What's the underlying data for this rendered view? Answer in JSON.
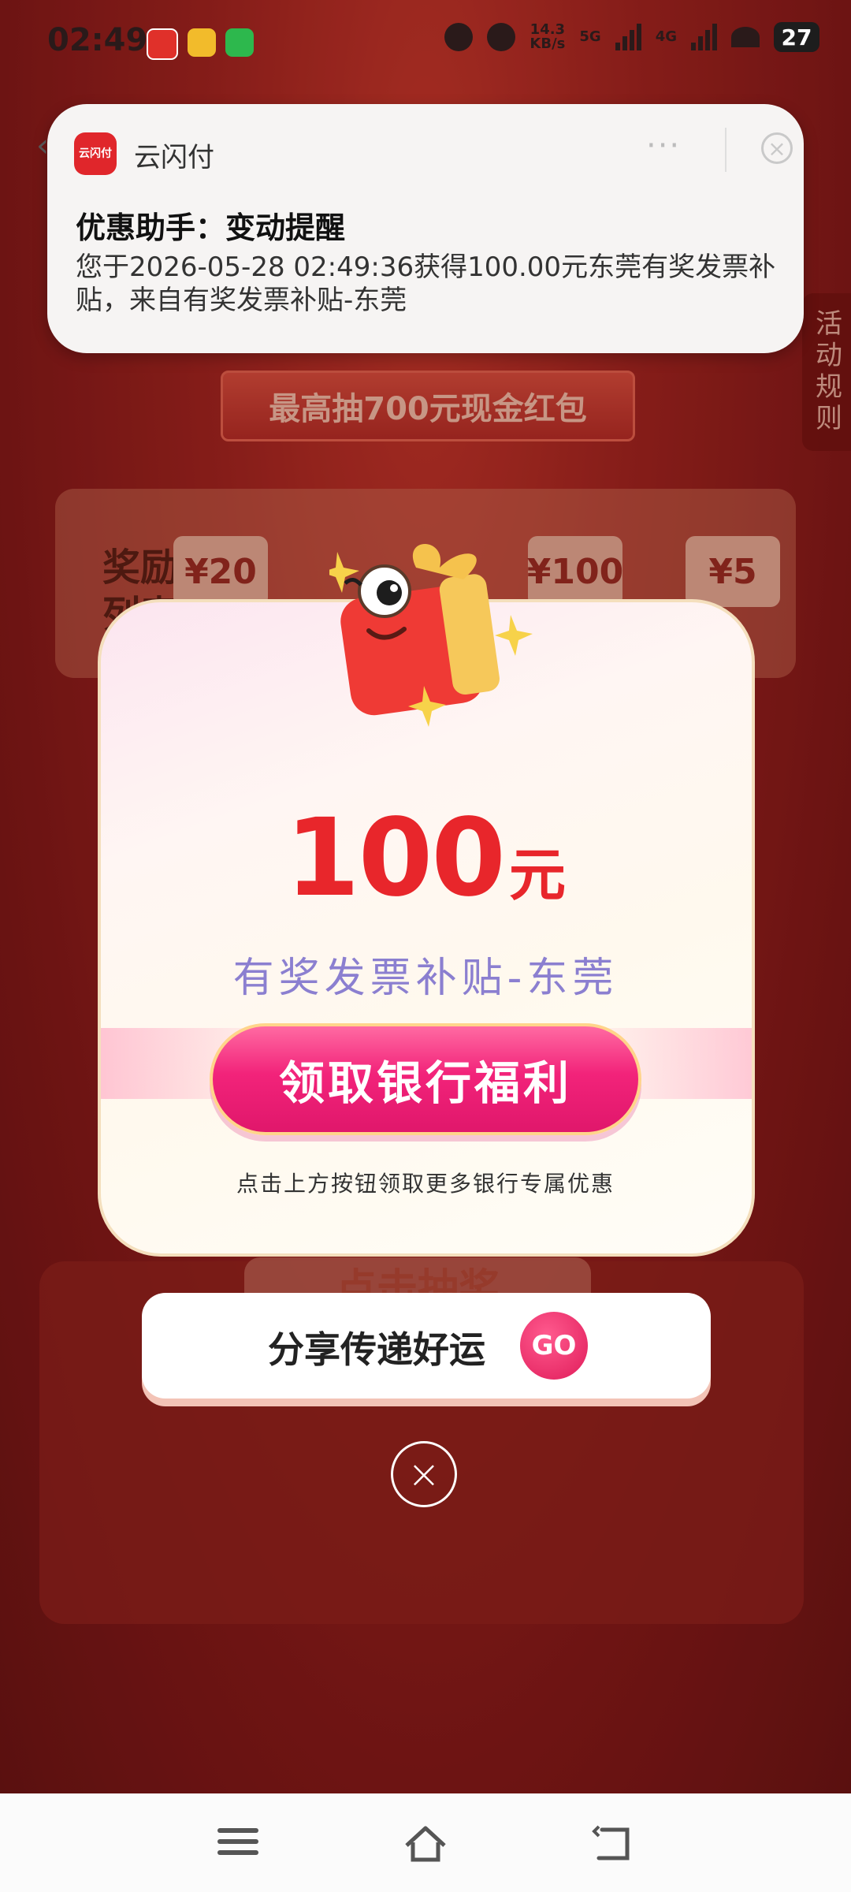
{
  "status_bar": {
    "time": "02:49",
    "net_speed": "14.3",
    "net_unit": "KB/s",
    "sim1": "5G",
    "sim2": "4G",
    "battery": "27"
  },
  "notification": {
    "app_name": "云闪付",
    "app_icon_text": "云闪付",
    "title": "优惠助手：变动提醒",
    "body": "您于2026-05-28 02:49:36获得100.00元东莞有奖发票补贴，来自有奖发票补贴-东莞",
    "more": "···",
    "close": "×",
    "back": "‹"
  },
  "background": {
    "banner": "最高抽700元现金红包",
    "rules": "活动规则",
    "reward_title": "奖励列表",
    "chips": [
      "¥20",
      "¥100",
      "¥5"
    ],
    "draw_label": "点击抽奖"
  },
  "modal": {
    "amount": "100",
    "unit": "元",
    "subsidy_name": "有奖发票补贴-东莞",
    "claim_button": "领取银行福利",
    "claim_hint": "点击上方按钮领取更多银行专属优惠",
    "share_text": "分享传递好运",
    "go": "GO",
    "close": "×"
  },
  "colors": {
    "accent": "#e8262b",
    "button_pink": "#f2237a",
    "subsidy_text": "#8b7fd0"
  }
}
